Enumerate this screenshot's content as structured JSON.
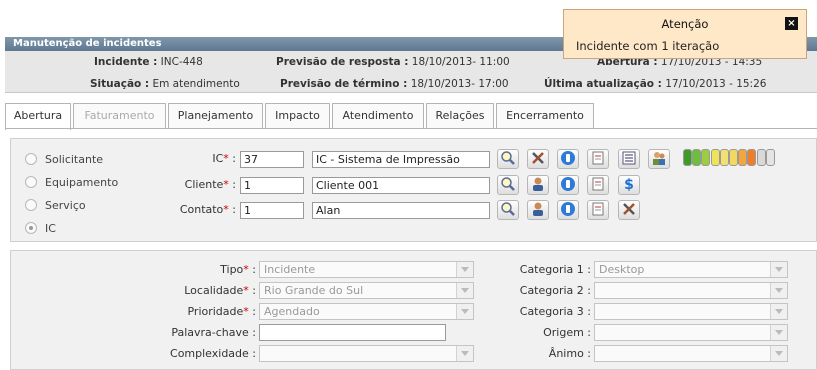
{
  "window": {
    "title": "Manutenção de incidentes"
  },
  "info": {
    "incidente_label": "Incidente :",
    "incidente_value": "INC-448",
    "situacao_label": "Situação :",
    "situacao_value": "Em atendimento",
    "prev_resposta_label": "Previsão de resposta :",
    "prev_resposta_value": "18/10/2013- 11:00",
    "prev_termino_label": "Previsão de término :",
    "prev_termino_value": "18/10/2013- 17:00",
    "abertura_label": "Abertura :",
    "abertura_value": "17/10/2013 - 14:35",
    "ultima_label": "Última atualização :",
    "ultima_value": "17/10/2013 - 15:26"
  },
  "tabs": [
    {
      "label": "Abertura",
      "state": "active"
    },
    {
      "label": "Faturamento",
      "state": "disabled"
    },
    {
      "label": "Planejamento",
      "state": "normal"
    },
    {
      "label": "Impacto",
      "state": "normal"
    },
    {
      "label": "Atendimento",
      "state": "normal"
    },
    {
      "label": "Relações",
      "state": "normal"
    },
    {
      "label": "Encerramento",
      "state": "normal"
    }
  ],
  "radios": [
    {
      "label": "Solicitante",
      "checked": false
    },
    {
      "label": "Equipamento",
      "checked": false
    },
    {
      "label": "Serviço",
      "checked": false
    },
    {
      "label": "IC",
      "checked": true
    }
  ],
  "fields": {
    "ic": {
      "label": "IC",
      "required": "*",
      "colon": " :",
      "code": "37",
      "desc": "IC - Sistema de Impressão"
    },
    "cliente": {
      "label": "Cliente",
      "required": "*",
      "colon": " :",
      "code": "1",
      "desc": "Cliente 001"
    },
    "contato": {
      "label": "Contato",
      "required": "*",
      "colon": " :",
      "code": "1",
      "desc": "Alan"
    }
  },
  "priority_bar": {
    "colors": [
      "#3f9a2a",
      "#6cbf3a",
      "#9ccc3f",
      "#efe35a",
      "#f2e070",
      "#f5d860",
      "#f2a640",
      "#ee7f2a",
      "#d9d9d9",
      "#e4e4e4"
    ],
    "level_fraction": 0.8
  },
  "classification": {
    "tipo": {
      "label": "Tipo",
      "required": "*",
      "value": "Incidente"
    },
    "localidade": {
      "label": "Localidade",
      "required": "*",
      "value": "Rio Grande do Sul"
    },
    "prioridade": {
      "label": "Prioridade",
      "required": "*",
      "value": "Agendado"
    },
    "palavra_chave": {
      "label": "Palavra-chave",
      "value": ""
    },
    "complexidade": {
      "label": "Complexidade",
      "value": ""
    },
    "categoria1": {
      "label": "Categoria 1",
      "value": "Desktop"
    },
    "categoria2": {
      "label": "Categoria 2",
      "value": ""
    },
    "categoria3": {
      "label": "Categoria 3",
      "value": ""
    },
    "origem": {
      "label": "Origem",
      "value": ""
    },
    "animo": {
      "label": "Ânimo",
      "value": ""
    },
    "colon": " :"
  },
  "toast": {
    "title": "Atenção",
    "message": "Incidente com 1 iteração",
    "close": "×"
  }
}
